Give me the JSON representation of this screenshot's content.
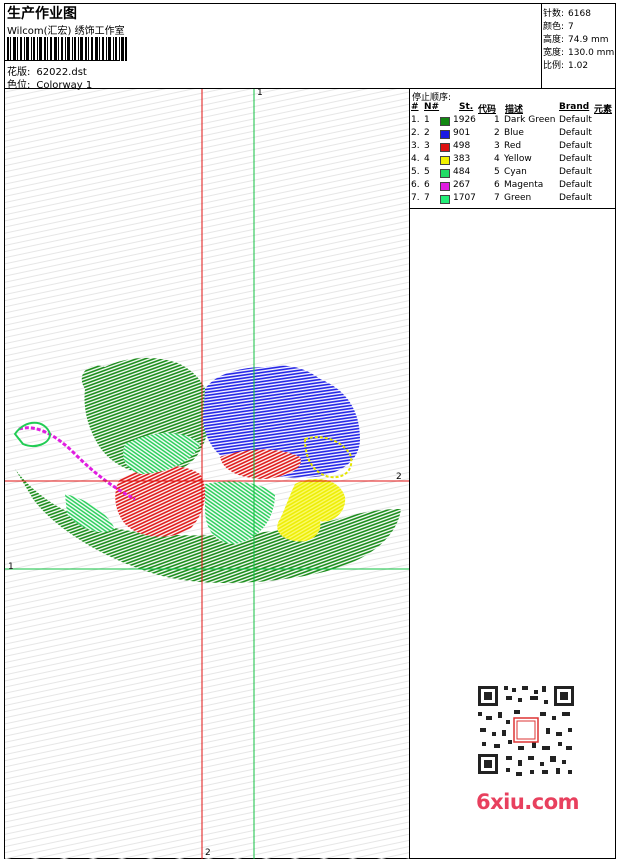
{
  "header": {
    "title": "生产作业图",
    "company": "Wilcom(汇宏) 绣饰工作室",
    "design_label": "花版:",
    "design_value": "62022.dst",
    "colorway_label": "色位:",
    "colorway_value": "Colorway 1"
  },
  "stats": [
    {
      "label": "针数:",
      "value": "6168"
    },
    {
      "label": "颜色:",
      "value": "7"
    },
    {
      "label": "高度:",
      "value": "74.9 mm"
    },
    {
      "label": "宽度:",
      "value": "130.0 mm"
    },
    {
      "label": "比例:",
      "value": "1.02"
    }
  ],
  "stop_sequence": {
    "title": "停止顺序:",
    "headers": [
      "#",
      "N#",
      "St.",
      "代码",
      "描述",
      "Brand",
      "元素"
    ],
    "rows": [
      {
        "num": "1.",
        "n": "1",
        "color": "#118811",
        "st": "1926",
        "code": "1",
        "desc": "Dark Green",
        "brand": "Default"
      },
      {
        "num": "2.",
        "n": "2",
        "color": "#1a1ae6",
        "st": "901",
        "code": "2",
        "desc": "Blue",
        "brand": "Default"
      },
      {
        "num": "3.",
        "n": "3",
        "color": "#dd1111",
        "st": "498",
        "code": "3",
        "desc": "Red",
        "brand": "Default"
      },
      {
        "num": "4.",
        "n": "4",
        "color": "#f2f200",
        "st": "383",
        "code": "4",
        "desc": "Yellow",
        "brand": "Default"
      },
      {
        "num": "5.",
        "n": "5",
        "color": "#22dd66",
        "st": "484",
        "code": "5",
        "desc": "Cyan",
        "brand": "Default"
      },
      {
        "num": "6.",
        "n": "6",
        "color": "#e01ee0",
        "st": "267",
        "code": "6",
        "desc": "Magenta",
        "brand": "Default"
      },
      {
        "num": "7.",
        "n": "7",
        "color": "#22ee77",
        "st": "1707",
        "code": "7",
        "desc": "Green",
        "brand": "Default"
      }
    ]
  },
  "axis_labels": {
    "green_v": "1",
    "green_h": "1",
    "red_v": "2",
    "red_h": "2"
  },
  "watermark": "6xiu.com",
  "colors": {
    "axis_red": "#e01010",
    "axis_green": "#10c040",
    "frame": "#000000"
  }
}
